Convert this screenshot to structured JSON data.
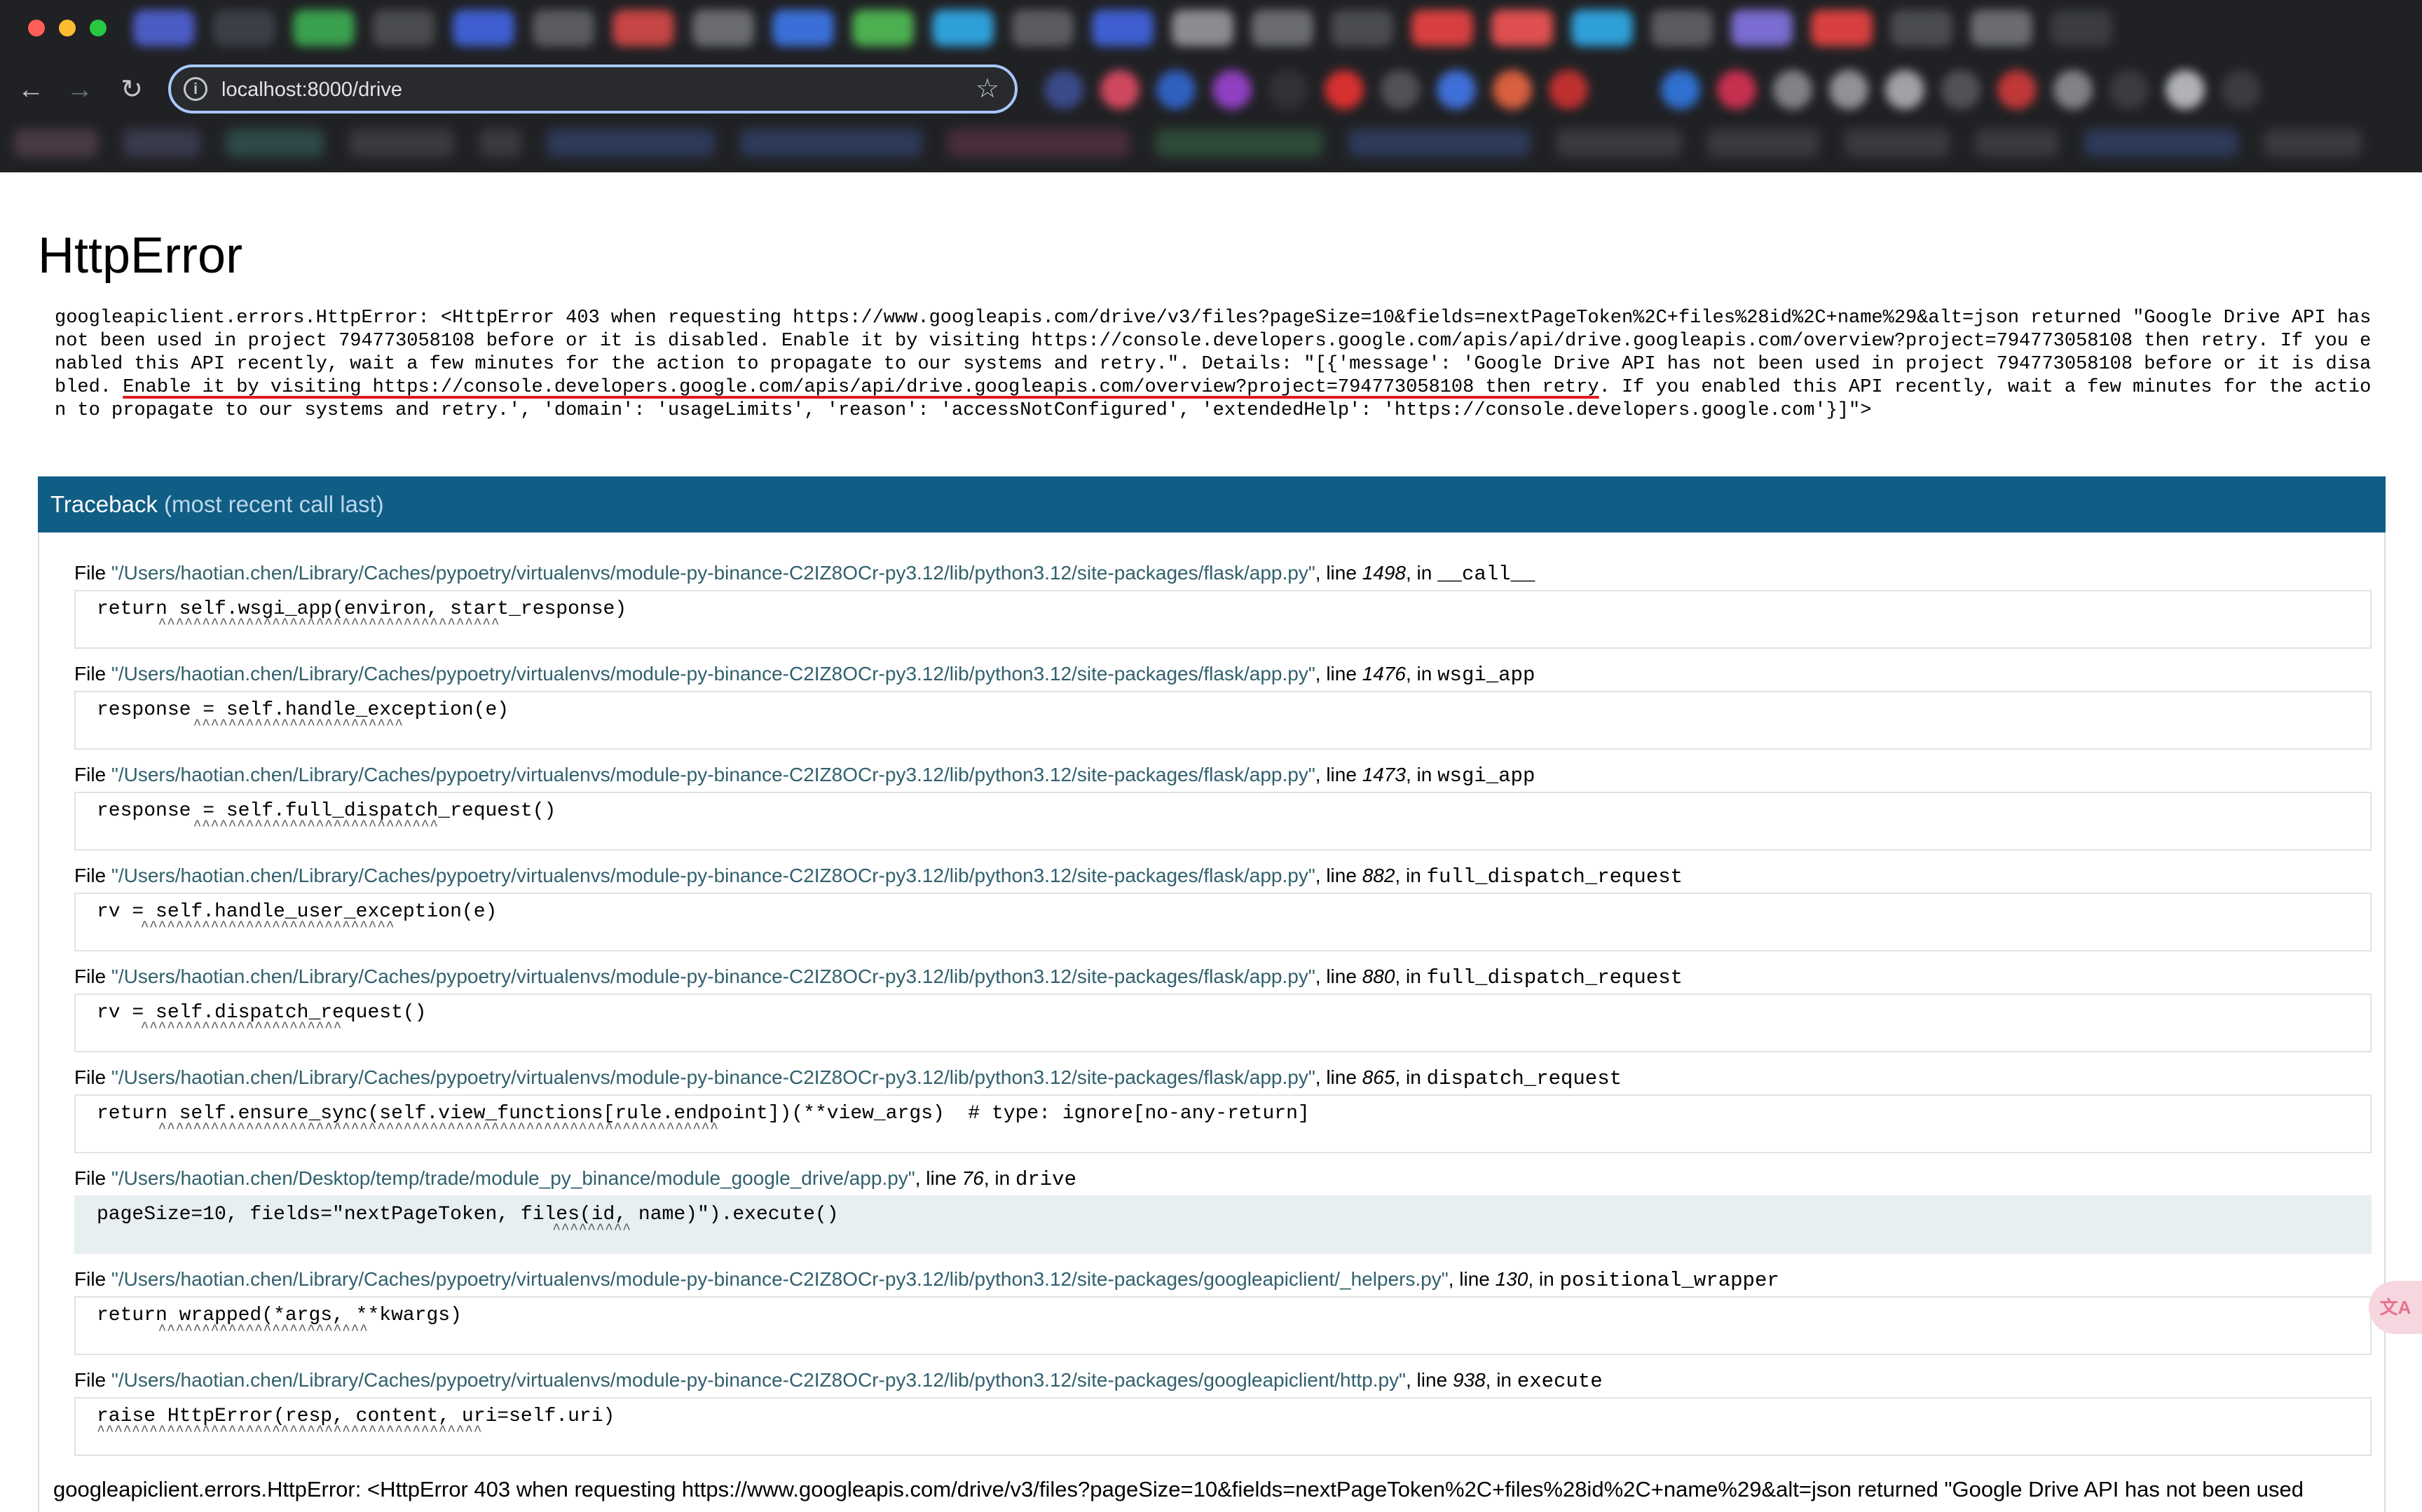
{
  "browser": {
    "url": "localhost:8000/drive",
    "icons": {
      "back": "arrow-left-icon",
      "forward": "arrow-right-icon",
      "reload": "reload-icon",
      "info": "info-icon",
      "bookmark": "star-icon"
    }
  },
  "page": {
    "title": "HttpError",
    "error_detail_pre": "googleapiclient.errors.HttpError: <HttpError 403 when requesting https://www.googleapis.com/drive/v3/files?pageSize=10&fields=nextPageToken%2C+files%28id%2C+name%29&alt=json returned \"Google Drive API has not been used in project 794773058108 before or it is disabled. Enable it by visiting https://console.developers.google.com/apis/api/drive.googleapis.com/overview?project=794773058108 then retry. If you enabled this API recently, wait a few minutes for the action to propagate to our systems and retry.\". Details: \"[{'message': 'Google Drive API has not been used in project 794773058108 before or it is disabled. ",
    "error_detail_underlined": "Enable it by visiting https://console.developers.google.com/apis/api/drive.googleapis.com/overview?project=794773058108 then retry",
    "error_detail_post": ". If you enabled this API recently, wait a few minutes for the action to propagate to our systems and retry.', 'domain': 'usageLimits', 'reason': 'accessNotConfigured', 'extendedHelp': 'https://console.developers.google.com'}]\">",
    "traceback_title": "Traceback",
    "traceback_subtitle": "(most recent call last)",
    "frames": [
      {
        "path": "\"/Users/haotian.chen/Library/Caches/pypoetry/virtualenvs/module-py-binance-C2IZ8OCr-py3.12/lib/python3.12/site-packages/flask/app.py\"",
        "line": "1498",
        "func": "__call__",
        "code": "return self.wsgi_app(environ, start_response)",
        "caret": "       ^^^^^^^^^^^^^^^^^^^^^^^^^^^^^^^^^^^^^^^"
      },
      {
        "path": "\"/Users/haotian.chen/Library/Caches/pypoetry/virtualenvs/module-py-binance-C2IZ8OCr-py3.12/lib/python3.12/site-packages/flask/app.py\"",
        "line": "1476",
        "func": "wsgi_app",
        "code": "response = self.handle_exception(e)",
        "caret": "           ^^^^^^^^^^^^^^^^^^^^^^^^"
      },
      {
        "path": "\"/Users/haotian.chen/Library/Caches/pypoetry/virtualenvs/module-py-binance-C2IZ8OCr-py3.12/lib/python3.12/site-packages/flask/app.py\"",
        "line": "1473",
        "func": "wsgi_app",
        "code": "response = self.full_dispatch_request()",
        "caret": "           ^^^^^^^^^^^^^^^^^^^^^^^^^^^^"
      },
      {
        "path": "\"/Users/haotian.chen/Library/Caches/pypoetry/virtualenvs/module-py-binance-C2IZ8OCr-py3.12/lib/python3.12/site-packages/flask/app.py\"",
        "line": "882",
        "func": "full_dispatch_request",
        "code": "rv = self.handle_user_exception(e)",
        "caret": "     ^^^^^^^^^^^^^^^^^^^^^^^^^^^^^"
      },
      {
        "path": "\"/Users/haotian.chen/Library/Caches/pypoetry/virtualenvs/module-py-binance-C2IZ8OCr-py3.12/lib/python3.12/site-packages/flask/app.py\"",
        "line": "880",
        "func": "full_dispatch_request",
        "code": "rv = self.dispatch_request()",
        "caret": "     ^^^^^^^^^^^^^^^^^^^^^^^"
      },
      {
        "path": "\"/Users/haotian.chen/Library/Caches/pypoetry/virtualenvs/module-py-binance-C2IZ8OCr-py3.12/lib/python3.12/site-packages/flask/app.py\"",
        "line": "865",
        "func": "dispatch_request",
        "code": "return self.ensure_sync(self.view_functions[rule.endpoint])(**view_args)  # type: ignore[no-any-return]",
        "caret": "       ^^^^^^^^^^^^^^^^^^^^^^^^^^^^^^^^^^^^^^^^^^^^^^^^^^^^^^^^^^^^^^^^"
      },
      {
        "path": "\"/Users/haotian.chen/Desktop/temp/trade/module_py_binance/module_google_drive/app.py\"",
        "line": "76",
        "func": "drive",
        "code": "pageSize=10, fields=\"nextPageToken, files(id, name)\").execute()",
        "caret": "                                                    ^^^^^^^^^",
        "highlight": true
      },
      {
        "path": "\"/Users/haotian.chen/Library/Caches/pypoetry/virtualenvs/module-py-binance-C2IZ8OCr-py3.12/lib/python3.12/site-packages/googleapiclient/_helpers.py\"",
        "line": "130",
        "func": "positional_wrapper",
        "code": "return wrapped(*args, **kwargs)",
        "caret": "       ^^^^^^^^^^^^^^^^^^^^^^^^"
      },
      {
        "path": "\"/Users/haotian.chen/Library/Caches/pypoetry/virtualenvs/module-py-binance-C2IZ8OCr-py3.12/lib/python3.12/site-packages/googleapiclient/http.py\"",
        "line": "938",
        "func": "execute",
        "code": "raise HttpError(resp, content, uri=self.uri)",
        "caret": "^^^^^^^^^^^^^^^^^^^^^^^^^^^^^^^^^^^^^^^^^^^^"
      }
    ],
    "file_label": "File",
    "line_label": ", line",
    "in_label": ", in",
    "bottom_error": "googleapiclient.errors.HttpError: <HttpError 403 when requesting https://www.googleapis.com/drive/v3/files?pageSize=10&fields=nextPageToken%2C+files%28id%2C+name%29&alt=json returned \"Google Drive API has not been used"
  },
  "colors": {
    "traceback_header": "#105d85",
    "path_text": "#31606d",
    "underline": "#e0191f",
    "highlight_bg": "#e8eff1"
  },
  "translate_icon": "translate-icon"
}
